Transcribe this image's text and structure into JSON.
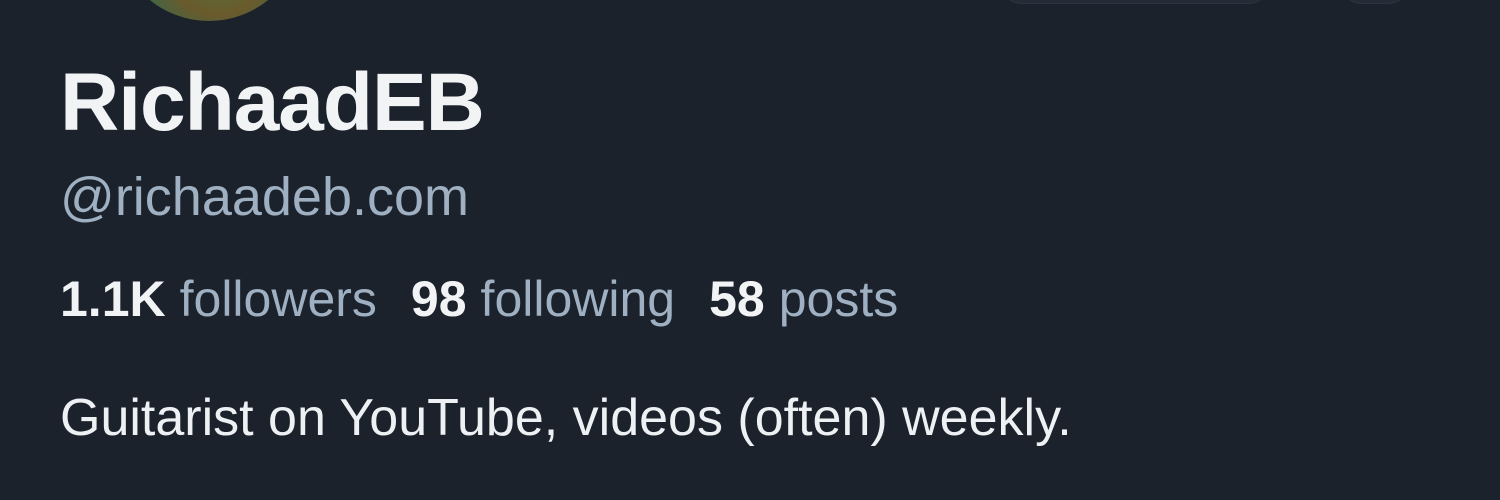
{
  "profile": {
    "display_name": "RichaadEB",
    "handle": "@richaadeb.com",
    "bio": "Guitarist on YouTube, videos (often) weekly."
  },
  "stats": {
    "followers": {
      "value": "1.1K",
      "label": "followers"
    },
    "following": {
      "value": "98",
      "label": "following"
    },
    "posts": {
      "value": "58",
      "label": "posts"
    }
  },
  "colors": {
    "background": "#1b222b",
    "primary_text": "#f1f3f5",
    "secondary_text": "#9fb0c2"
  }
}
